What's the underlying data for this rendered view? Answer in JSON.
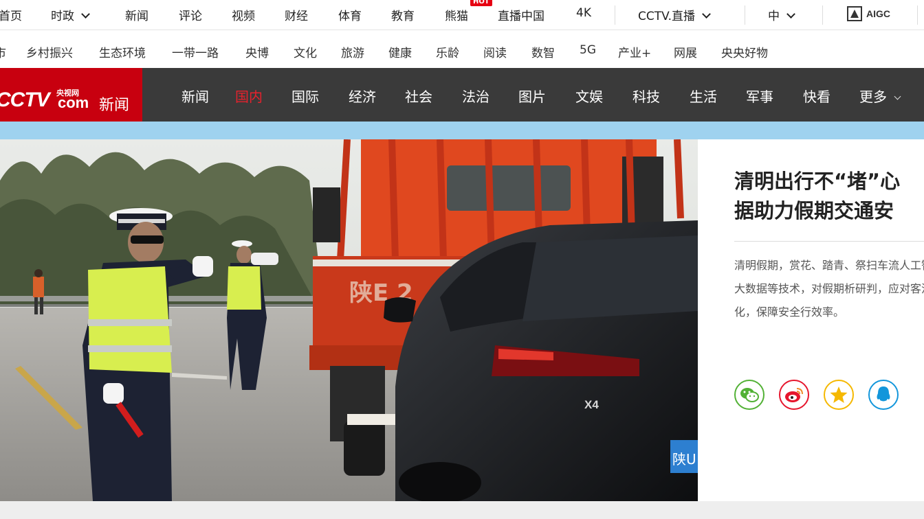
{
  "top_nav": {
    "items": [
      "首页",
      "时政",
      "新闻",
      "评论",
      "视频",
      "财经",
      "体育",
      "教育",
      "熊猫",
      "直播中国",
      "4K"
    ],
    "hot_badge": "HOT",
    "live": "CCTV.直播",
    "language": "中",
    "aigc": "AIGC"
  },
  "sub_nav": {
    "items": [
      "市",
      "乡村振兴",
      "生态环境",
      "一带一路",
      "央博",
      "文化",
      "旅游",
      "健康",
      "乐龄",
      "阅读",
      "数智",
      "5G",
      "产业+",
      "网展",
      "央央好物"
    ]
  },
  "channel_bar": {
    "logo": {
      "cctv": "CCTV",
      "net": "央视网",
      "com": "com",
      "news": "新闻"
    },
    "items": [
      "新闻",
      "国内",
      "国际",
      "经济",
      "社会",
      "法治",
      "图片",
      "文娱",
      "科技",
      "生活",
      "军事",
      "快看",
      "更多"
    ],
    "active": "国内"
  },
  "hero": {
    "truck_text": "陕E 2",
    "car_model": "X4",
    "plate": "陕U"
  },
  "article": {
    "headline_lines": [
      "清明出行不“堵”心",
      "据助力假期交通安"
    ],
    "summary": "清明假期，赏花、踏青、祭扫车流人工智能、大数据等技术，对假期析研判，应对客流变化，保障安全行效率。"
  },
  "share": [
    {
      "name": "wechat",
      "color": "#52b135"
    },
    {
      "name": "weibo",
      "color": "#e6162d"
    },
    {
      "name": "qzone",
      "color": "#f5b800"
    },
    {
      "name": "qq",
      "color": "#1296db"
    }
  ]
}
